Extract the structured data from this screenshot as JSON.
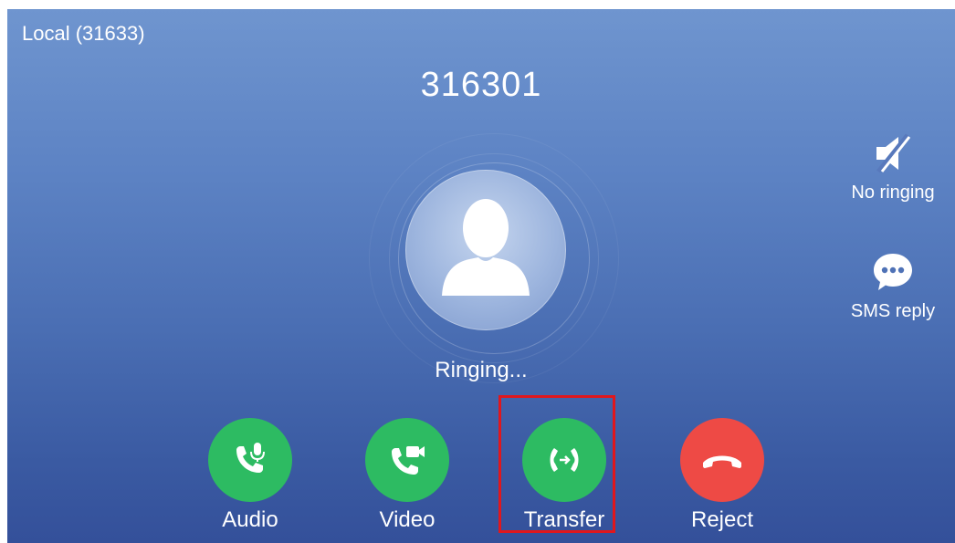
{
  "account_label": "Local (31633)",
  "caller_number": "316301",
  "call_status": "Ringing...",
  "side_actions": {
    "no_ringing": {
      "label": "No ringing",
      "icon": "speaker-mute-icon"
    },
    "sms_reply": {
      "label": "SMS reply",
      "icon": "chat-bubble-icon"
    }
  },
  "actions": {
    "audio": {
      "label": "Audio",
      "icon": "phone-mic-icon",
      "color": "#2dbb62"
    },
    "video": {
      "label": "Video",
      "icon": "phone-video-icon",
      "color": "#2dbb62"
    },
    "transfer": {
      "label": "Transfer",
      "icon": "call-transfer-icon",
      "color": "#2dbb62"
    },
    "reject": {
      "label": "Reject",
      "icon": "hang-up-icon",
      "color": "#ee4a45"
    }
  },
  "highlight_color": "#e0171d"
}
